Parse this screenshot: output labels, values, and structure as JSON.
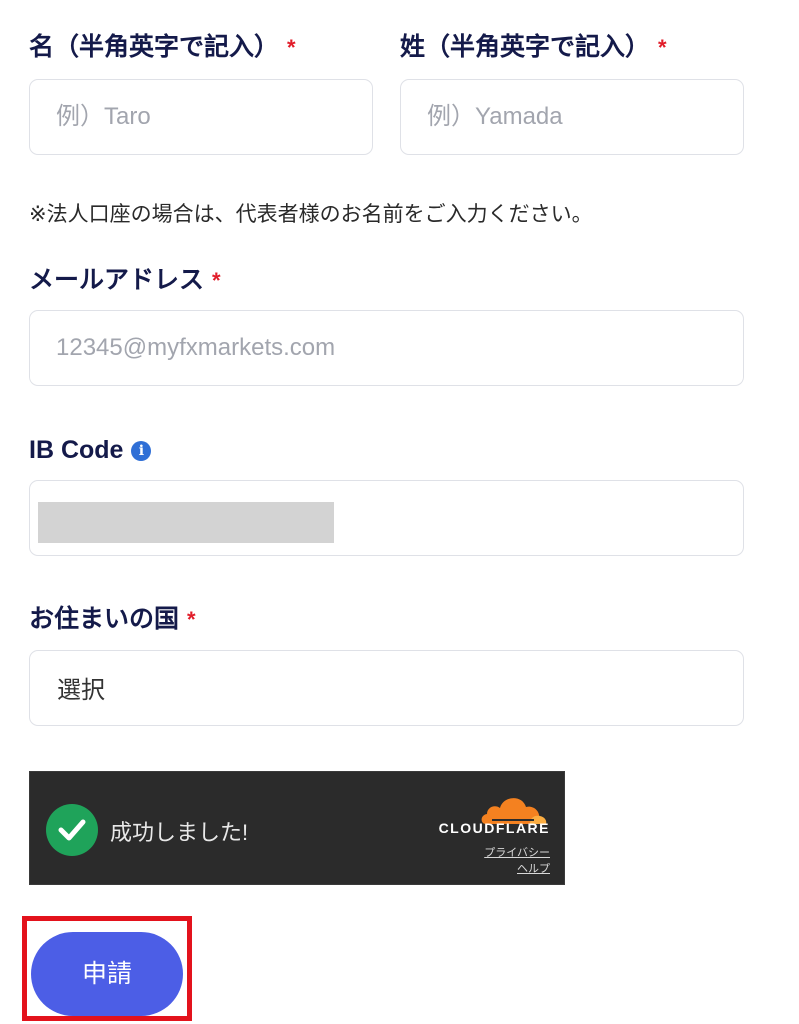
{
  "form": {
    "first_name": {
      "label": "名（半角英字で記入）",
      "required_mark": "*",
      "placeholder": "例）Taro",
      "value": ""
    },
    "last_name": {
      "label": "姓（半角英字で記入）",
      "required_mark": "*",
      "placeholder": "例）Yamada",
      "value": ""
    },
    "note": "※法人口座の場合は、代表者様のお名前をご入力ください。",
    "email": {
      "label": "メールアドレス",
      "required_mark": "*",
      "placeholder": "12345@myfxmarkets.com",
      "value": ""
    },
    "ib_code": {
      "label": "IB Code",
      "info_icon": "info-circle-icon",
      "info_glyph": "i"
    },
    "country": {
      "label": "お住まいの国",
      "required_mark": "*",
      "selected": "選択"
    }
  },
  "captcha": {
    "status_text": "成功しました!",
    "brand": "CLOUDFLARE",
    "privacy_link": "プライバシー",
    "help_link": "ヘルプ",
    "success_color": "#1fa35a",
    "brand_color": "#f48120"
  },
  "submit": {
    "label": "申請",
    "color": "#4c5ee6"
  },
  "highlight_color": "#e3121c"
}
